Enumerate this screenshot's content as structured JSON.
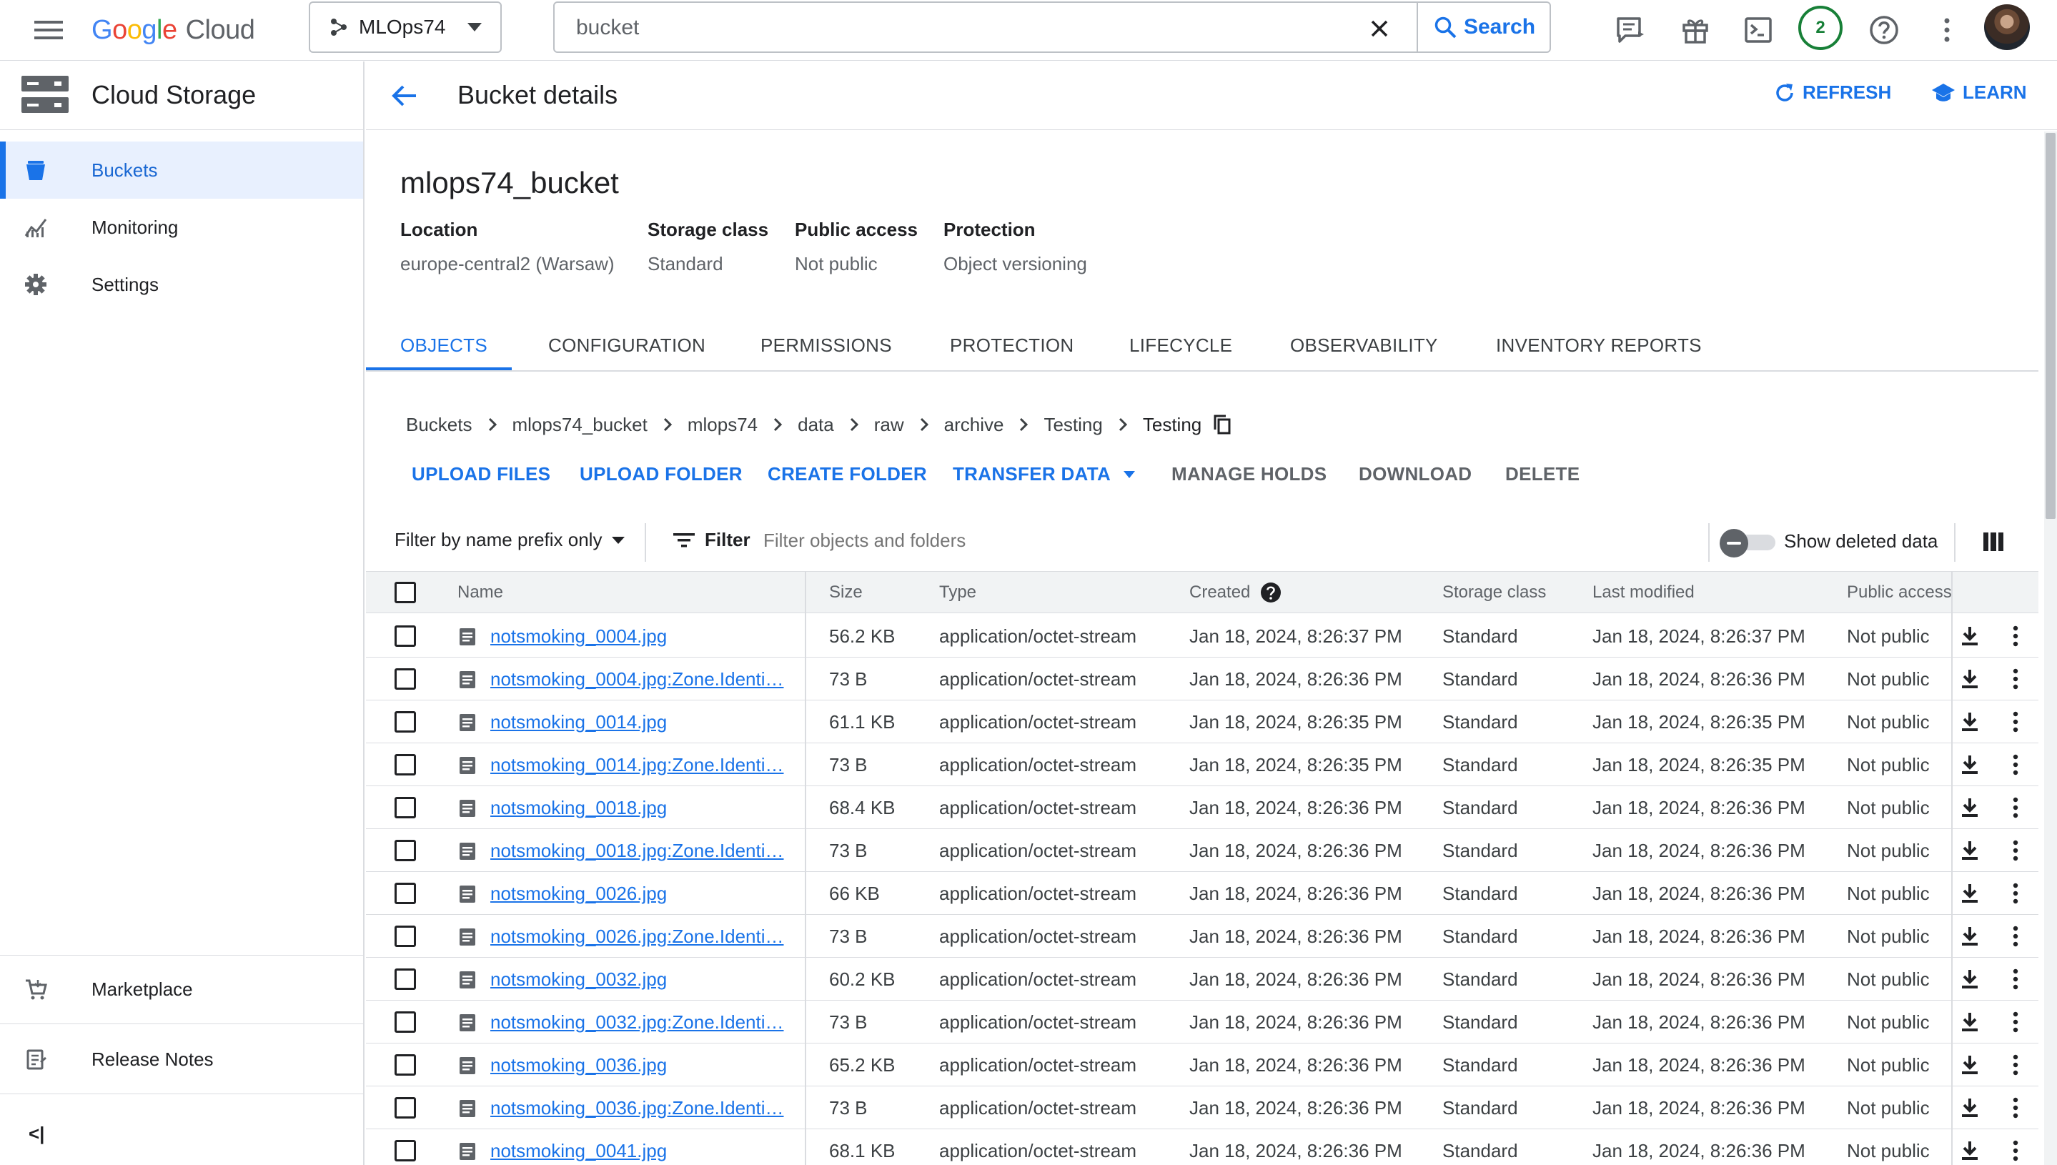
{
  "topbar": {
    "logo_google": [
      "G",
      "o",
      "o",
      "g",
      "l",
      "e"
    ],
    "logo_cloud": "Cloud",
    "project": "MLOps74",
    "search_value": "bucket",
    "search_button": "Search",
    "notifications_count": "2"
  },
  "sidebar": {
    "product_title": "Cloud Storage",
    "items": [
      {
        "label": "Buckets",
        "icon": "bucket-icon",
        "active": true
      },
      {
        "label": "Monitoring",
        "icon": "monitoring-icon",
        "active": false
      },
      {
        "label": "Settings",
        "icon": "gear-icon",
        "active": false
      }
    ],
    "bottom_items": [
      {
        "label": "Marketplace",
        "icon": "cart-icon"
      },
      {
        "label": "Release Notes",
        "icon": "notes-icon"
      }
    ],
    "collapse_label": "<|"
  },
  "header": {
    "title": "Bucket details",
    "refresh": "REFRESH",
    "learn": "LEARN"
  },
  "bucket": {
    "name": "mlops74_bucket",
    "info": [
      {
        "label": "Location",
        "value": "europe-central2 (Warsaw)"
      },
      {
        "label": "Storage class",
        "value": "Standard"
      },
      {
        "label": "Public access",
        "value": "Not public"
      },
      {
        "label": "Protection",
        "value": "Object versioning"
      }
    ]
  },
  "tabs": [
    "OBJECTS",
    "CONFIGURATION",
    "PERMISSIONS",
    "PROTECTION",
    "LIFECYCLE",
    "OBSERVABILITY",
    "INVENTORY REPORTS"
  ],
  "breadcrumb": [
    "Buckets",
    "mlops74_bucket",
    "mlops74",
    "data",
    "raw",
    "archive",
    "Testing",
    "Testing"
  ],
  "actions": {
    "upload_files": "UPLOAD FILES",
    "upload_folder": "UPLOAD FOLDER",
    "create_folder": "CREATE FOLDER",
    "transfer_data": "TRANSFER DATA",
    "manage_holds": "MANAGE HOLDS",
    "download": "DOWNLOAD",
    "delete": "DELETE"
  },
  "filter": {
    "prefix_select": "Filter by name prefix only",
    "label": "Filter",
    "placeholder": "Filter objects and folders",
    "show_deleted": "Show deleted data"
  },
  "table": {
    "columns": [
      "Name",
      "Size",
      "Type",
      "Created",
      "Storage class",
      "Last modified",
      "Public access"
    ],
    "rows": [
      {
        "name": "notsmoking_0004.jpg",
        "size": "56.2 KB",
        "type": "application/octet-stream",
        "created": "Jan 18, 2024, 8:26:37 PM",
        "storage": "Standard",
        "modified": "Jan 18, 2024, 8:26:37 PM",
        "access": "Not public"
      },
      {
        "name": "notsmoking_0004.jpg:Zone.Identi…",
        "size": "73 B",
        "type": "application/octet-stream",
        "created": "Jan 18, 2024, 8:26:36 PM",
        "storage": "Standard",
        "modified": "Jan 18, 2024, 8:26:36 PM",
        "access": "Not public"
      },
      {
        "name": "notsmoking_0014.jpg",
        "size": "61.1 KB",
        "type": "application/octet-stream",
        "created": "Jan 18, 2024, 8:26:35 PM",
        "storage": "Standard",
        "modified": "Jan 18, 2024, 8:26:35 PM",
        "access": "Not public"
      },
      {
        "name": "notsmoking_0014.jpg:Zone.Identi…",
        "size": "73 B",
        "type": "application/octet-stream",
        "created": "Jan 18, 2024, 8:26:35 PM",
        "storage": "Standard",
        "modified": "Jan 18, 2024, 8:26:35 PM",
        "access": "Not public"
      },
      {
        "name": "notsmoking_0018.jpg",
        "size": "68.4 KB",
        "type": "application/octet-stream",
        "created": "Jan 18, 2024, 8:26:36 PM",
        "storage": "Standard",
        "modified": "Jan 18, 2024, 8:26:36 PM",
        "access": "Not public"
      },
      {
        "name": "notsmoking_0018.jpg:Zone.Identi…",
        "size": "73 B",
        "type": "application/octet-stream",
        "created": "Jan 18, 2024, 8:26:36 PM",
        "storage": "Standard",
        "modified": "Jan 18, 2024, 8:26:36 PM",
        "access": "Not public"
      },
      {
        "name": "notsmoking_0026.jpg",
        "size": "66 KB",
        "type": "application/octet-stream",
        "created": "Jan 18, 2024, 8:26:36 PM",
        "storage": "Standard",
        "modified": "Jan 18, 2024, 8:26:36 PM",
        "access": "Not public"
      },
      {
        "name": "notsmoking_0026.jpg:Zone.Identi…",
        "size": "73 B",
        "type": "application/octet-stream",
        "created": "Jan 18, 2024, 8:26:36 PM",
        "storage": "Standard",
        "modified": "Jan 18, 2024, 8:26:36 PM",
        "access": "Not public"
      },
      {
        "name": "notsmoking_0032.jpg",
        "size": "60.2 KB",
        "type": "application/octet-stream",
        "created": "Jan 18, 2024, 8:26:36 PM",
        "storage": "Standard",
        "modified": "Jan 18, 2024, 8:26:36 PM",
        "access": "Not public"
      },
      {
        "name": "notsmoking_0032.jpg:Zone.Identi…",
        "size": "73 B",
        "type": "application/octet-stream",
        "created": "Jan 18, 2024, 8:26:36 PM",
        "storage": "Standard",
        "modified": "Jan 18, 2024, 8:26:36 PM",
        "access": "Not public"
      },
      {
        "name": "notsmoking_0036.jpg",
        "size": "65.2 KB",
        "type": "application/octet-stream",
        "created": "Jan 18, 2024, 8:26:36 PM",
        "storage": "Standard",
        "modified": "Jan 18, 2024, 8:26:36 PM",
        "access": "Not public"
      },
      {
        "name": "notsmoking_0036.jpg:Zone.Identi…",
        "size": "73 B",
        "type": "application/octet-stream",
        "created": "Jan 18, 2024, 8:26:36 PM",
        "storage": "Standard",
        "modified": "Jan 18, 2024, 8:26:36 PM",
        "access": "Not public"
      },
      {
        "name": "notsmoking_0041.jpg",
        "size": "68.1 KB",
        "type": "application/octet-stream",
        "created": "Jan 18, 2024, 8:26:36 PM",
        "storage": "Standard",
        "modified": "Jan 18, 2024, 8:26:36 PM",
        "access": "Not public"
      }
    ]
  },
  "colors": {
    "accent": "#1a73e8",
    "active_nav_bg": "#e8f0fe",
    "badge_green": "#188038"
  }
}
